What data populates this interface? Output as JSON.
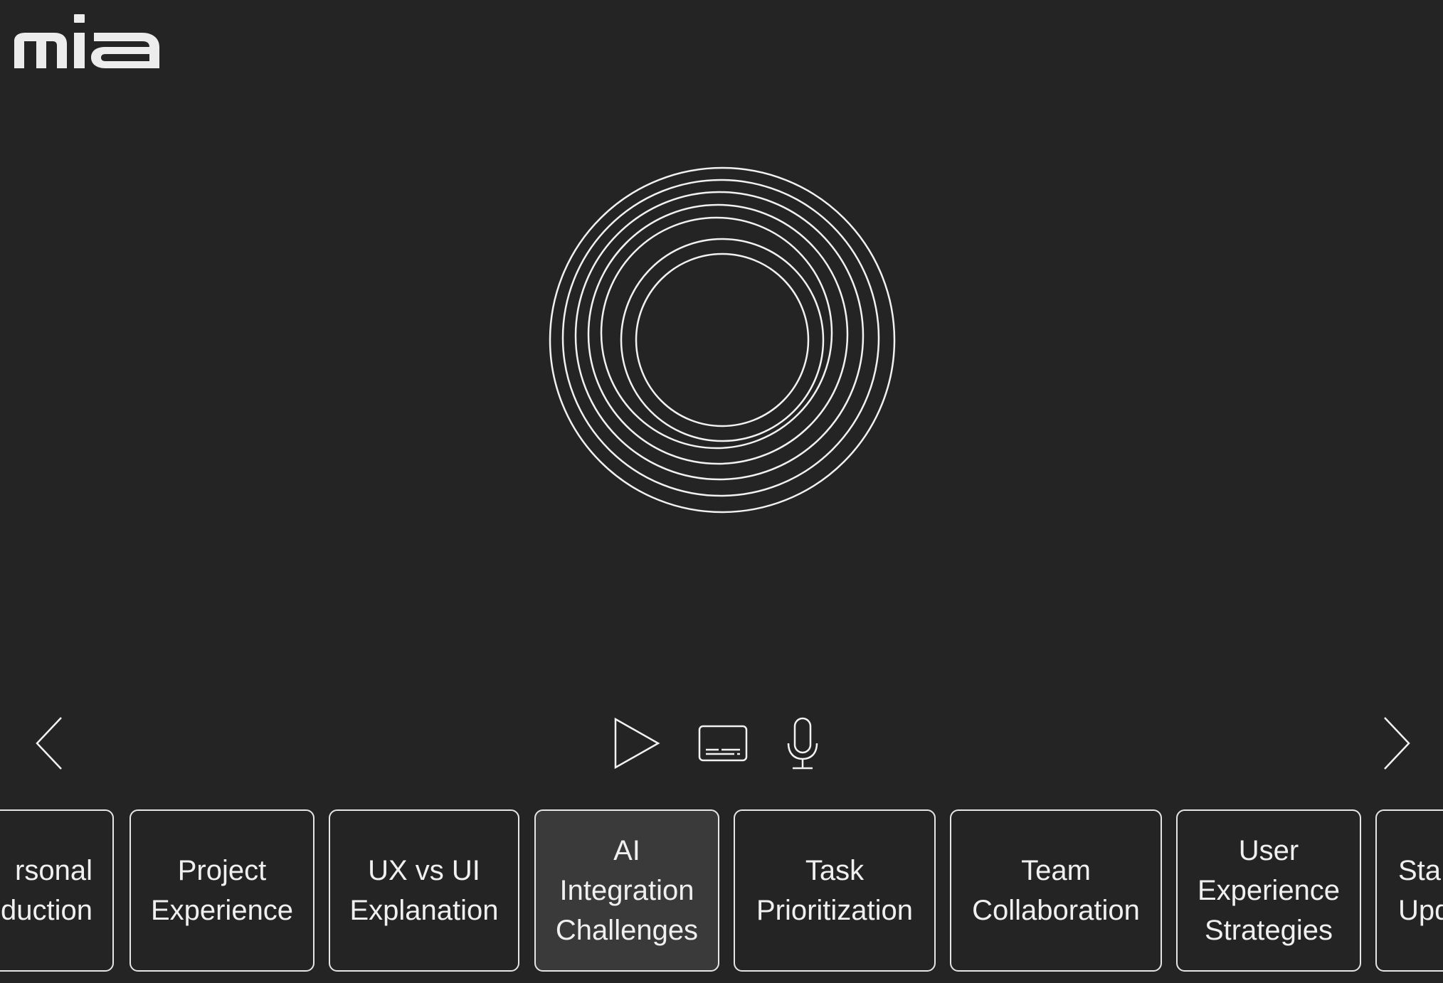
{
  "app": {
    "logo_text": "mia"
  },
  "controls": {
    "prev_icon": "chevron-left-icon",
    "next_icon": "chevron-right-icon",
    "play_icon": "play-icon",
    "captions_icon": "captions-icon",
    "mic_icon": "microphone-icon"
  },
  "topics": [
    {
      "label": "Personal Introduction",
      "visible_text": "rsonal\nduction",
      "active": false
    },
    {
      "label": "Project Experience",
      "visible_text": "Project\nExperience",
      "active": false
    },
    {
      "label": "UX vs UI Explanation",
      "visible_text": "UX vs UI\nExplanation",
      "active": false
    },
    {
      "label": "AI Integration Challenges",
      "visible_text": "AI\nIntegration\nChallenges",
      "active": true
    },
    {
      "label": "Task Prioritization",
      "visible_text": "Task\nPrioritization",
      "active": false
    },
    {
      "label": "Team Collaboration",
      "visible_text": "Team\nCollaboration",
      "active": false
    },
    {
      "label": "User Experience Strategies",
      "visible_text": "User\nExperience\nStrategies",
      "active": false
    },
    {
      "label": "Status Updates",
      "visible_text": "Sta\nUpd",
      "active": false
    }
  ],
  "colors": {
    "background": "#242424",
    "stroke": "#e6e6e6",
    "active_card": "#3a3a3a"
  }
}
